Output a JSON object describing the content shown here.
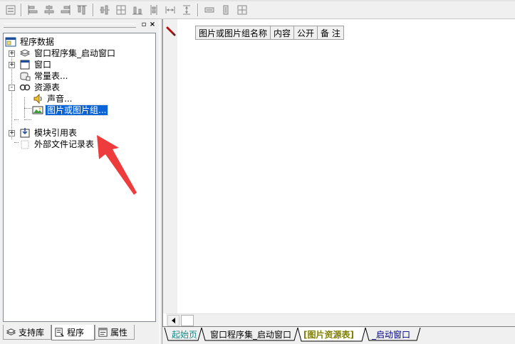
{
  "toolbar": {
    "buttons": [
      "form-icon",
      "align-left-icon",
      "align-center-v-icon",
      "align-right-icon",
      "align-top-icon",
      "align-middle-icon",
      "align-bottom-icon",
      "distribute-h-icon",
      "distribute-v-icon",
      "same-width-icon",
      "same-height-icon",
      "same-size-icon"
    ]
  },
  "left_panel": {
    "pin_label": "▫",
    "close_label": "×",
    "tree": {
      "root": "程序数据",
      "items": [
        {
          "label": "窗口程序集_启动窗口",
          "icon": "assembly-icon",
          "expander": "+"
        },
        {
          "label": "窗口",
          "icon": "window-icon",
          "expander": "+"
        },
        {
          "label": "常量表...",
          "icon": "constants-icon",
          "expander": ""
        },
        {
          "label": "资源表",
          "icon": "resources-icon",
          "expander": "-"
        },
        {
          "label": "声音...",
          "icon": "sound-icon",
          "expander": ""
        },
        {
          "label": "图片或图片组...",
          "icon": "picture-icon",
          "expander": "",
          "selected": true
        },
        {
          "label": "模块引用表",
          "icon": "module-icon",
          "expander": "+"
        },
        {
          "label": "外部文件记录表",
          "icon": "file-record-icon",
          "expander": ""
        }
      ]
    },
    "tabs": [
      {
        "label": "支持库",
        "icon": "library-icon"
      },
      {
        "label": "程序",
        "icon": "program-icon",
        "active": true
      },
      {
        "label": "属性",
        "icon": "properties-icon"
      }
    ]
  },
  "editor": {
    "columns": [
      "图片或图片组名称",
      "内容",
      "公开",
      "备 注"
    ]
  },
  "doc_tabs": [
    {
      "label": "起始页",
      "color": "#1a8a8a"
    },
    {
      "label": "窗口程序集_启动窗口",
      "color": "#000000"
    },
    {
      "label": "[图片资源表]",
      "color": "#808000",
      "active": true
    },
    {
      "label": "_启动窗口",
      "color": "#000080"
    }
  ],
  "colors": {
    "selection": "#0a64d8",
    "annotation_arrow": "#ee3b3b"
  }
}
